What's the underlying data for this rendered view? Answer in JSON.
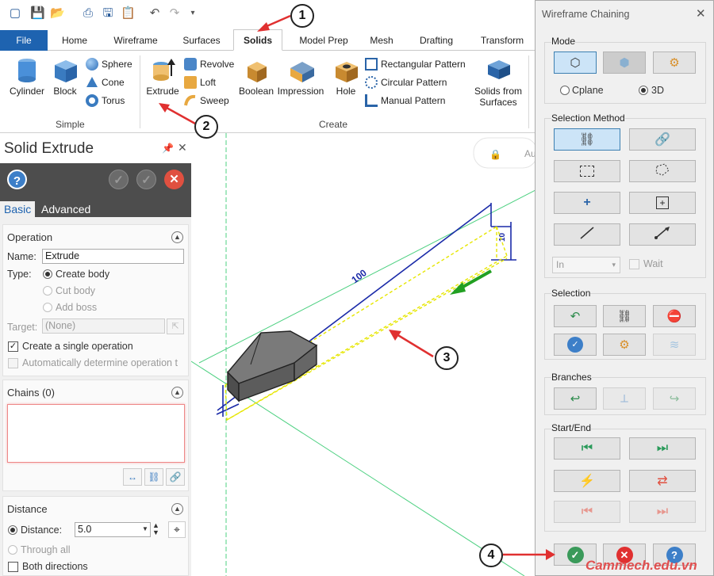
{
  "ribbon": {
    "tabs": [
      "File",
      "Home",
      "Wireframe",
      "Surfaces",
      "Solids",
      "Model Prep",
      "Mesh",
      "Drafting",
      "Transform"
    ],
    "simple_group": {
      "label": "Simple",
      "cylinder": "Cylinder",
      "block": "Block",
      "sphere": "Sphere",
      "cone": "Cone",
      "torus": "Torus"
    },
    "create_group": {
      "label": "Create",
      "extrude": "Extrude",
      "revolve": "Revolve",
      "loft": "Loft",
      "sweep": "Sweep",
      "boolean": "Boolean",
      "impression": "Impression",
      "hole": "Hole",
      "rect_pattern": "Rectangular Pattern",
      "circ_pattern": "Circular Pattern",
      "manual_pattern": "Manual Pattern",
      "solids_from_surfaces_1": "Solids from",
      "solids_from_surfaces_2": "Surfaces"
    }
  },
  "panel": {
    "title": "Solid Extrude",
    "tab_basic": "Basic",
    "tab_advanced": "Advanced",
    "operation": {
      "header": "Operation",
      "name_label": "Name:",
      "name_value": "Extrude",
      "type_label": "Type:",
      "create_body": "Create body",
      "cut_body": "Cut body",
      "add_boss": "Add boss",
      "target_label": "Target:",
      "target_value": "(None)",
      "single_op": "Create a single operation",
      "auto_op": "Automatically determine operation t"
    },
    "chains": {
      "header": "Chains (0)"
    },
    "distance": {
      "header": "Distance",
      "distance_label": "Distance:",
      "distance_value": "5.0",
      "through_all": "Through all",
      "both_directions": "Both directions"
    }
  },
  "viewport": {
    "dim_length": "100",
    "dim_height": "10",
    "autocursor": "Au"
  },
  "dialog": {
    "title": "Wireframe Chaining",
    "mode": {
      "header": "Mode",
      "cplane": "Cplane",
      "three_d": "3D"
    },
    "selection_method": {
      "header": "Selection Method",
      "in_value": "In",
      "wait": "Wait"
    },
    "selection": {
      "header": "Selection"
    },
    "branches": {
      "header": "Branches"
    },
    "start_end": {
      "header": "Start/End"
    }
  },
  "annotations": [
    "1",
    "2",
    "3",
    "4"
  ],
  "watermark": "Cammech.edu.vn",
  "colors": {
    "file_tab": "#1e63b0",
    "accent_red": "#e03030",
    "ok_green": "#3a9a5a",
    "help_blue": "#3d7fc8"
  }
}
